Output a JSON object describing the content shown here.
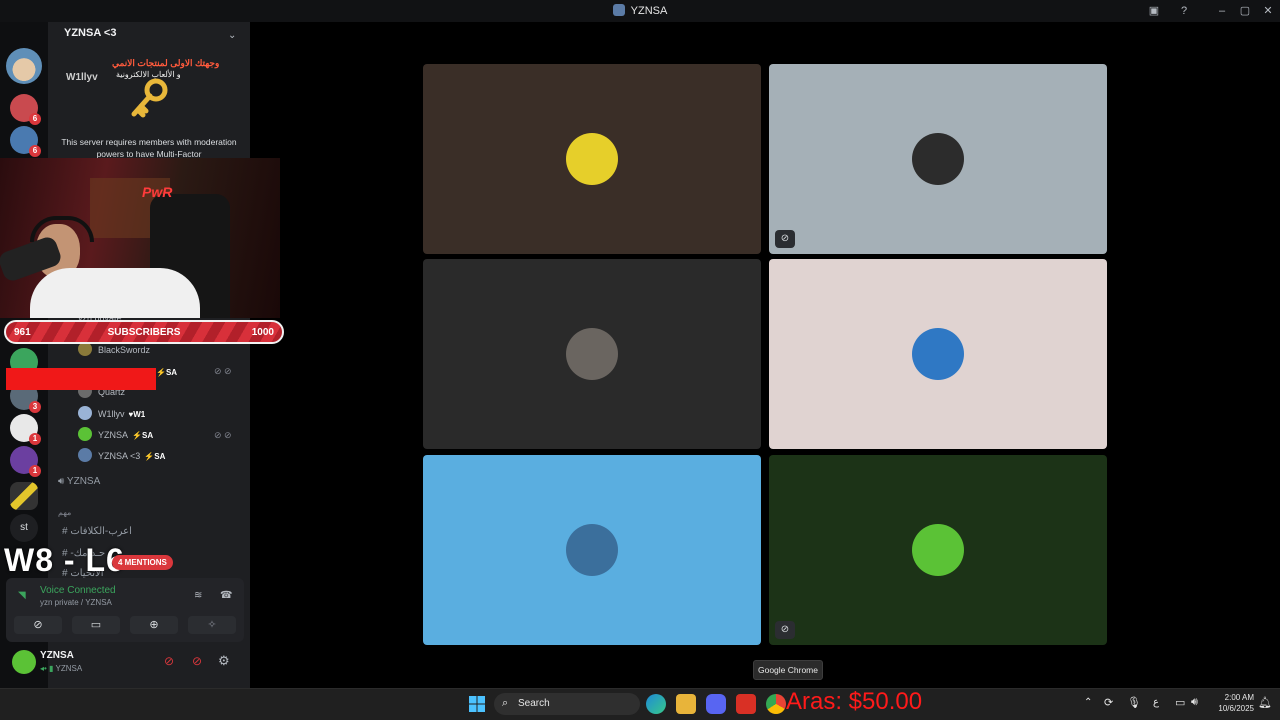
{
  "window": {
    "title": "YZNSA"
  },
  "server_header": {
    "name": "YZNSA <3",
    "username_overlap": "W1llyv"
  },
  "banner_arabic": {
    "line1": "وجهتك الاولى لمنتجات الانمي",
    "line2": "و الألعاب الالكترونية"
  },
  "notice": {
    "text": "This server requires members with moderation powers to have Multi-Factor"
  },
  "subscriber_bar": {
    "current": "961",
    "label": "SUBSCRIBERS",
    "goal": "1000"
  },
  "server_badges": [
    "6",
    "6",
    "3",
    "1",
    "1"
  ],
  "server_letter": "st",
  "voice_members": [
    {
      "name": "yzn private"
    },
    {
      "name": "BlackSwordz"
    },
    {
      "name": "",
      "tag": "SA"
    },
    {
      "name": "Quartz"
    },
    {
      "name": "W1llyv",
      "tag": "W1"
    },
    {
      "name": "YZNSA",
      "tag": "SA"
    },
    {
      "name": "YZNSA <3",
      "tag": "SA"
    }
  ],
  "voice_channel_2": "YZNSA",
  "category": "مهم",
  "text_channels": [
    "اعرب-الكلافات",
    "-حـد-مك",
    "الاتحيات"
  ],
  "overlay_score": "W8 - L6",
  "mentions_badge": "4 MENTIONS",
  "voice_connected": {
    "status": "Voice Connected",
    "location": "yzn private / YZNSA"
  },
  "user": {
    "name": "YZNSA",
    "status": "YZNSA"
  },
  "video_tiles": [
    {
      "bg": "#3a2e27",
      "avatar": "#e6cf2a"
    },
    {
      "bg": "#a5b0b7",
      "avatar": "#2c2c2c"
    },
    {
      "bg": "#2a2a2a",
      "avatar": "#6a6560"
    },
    {
      "bg": "#e0d3d1",
      "avatar": "#2f78c4"
    },
    {
      "bg": "#5aaee0",
      "avatar": "#3b6f9c"
    },
    {
      "bg": "#1c3317",
      "avatar": "#5bc236"
    }
  ],
  "tooltip": "Google Chrome",
  "taskbar": {
    "search_placeholder": "Search",
    "overlay_text": "Aras: $50.00",
    "time": "2:00 AM",
    "date": "10/6/2025",
    "lang": "ع"
  }
}
